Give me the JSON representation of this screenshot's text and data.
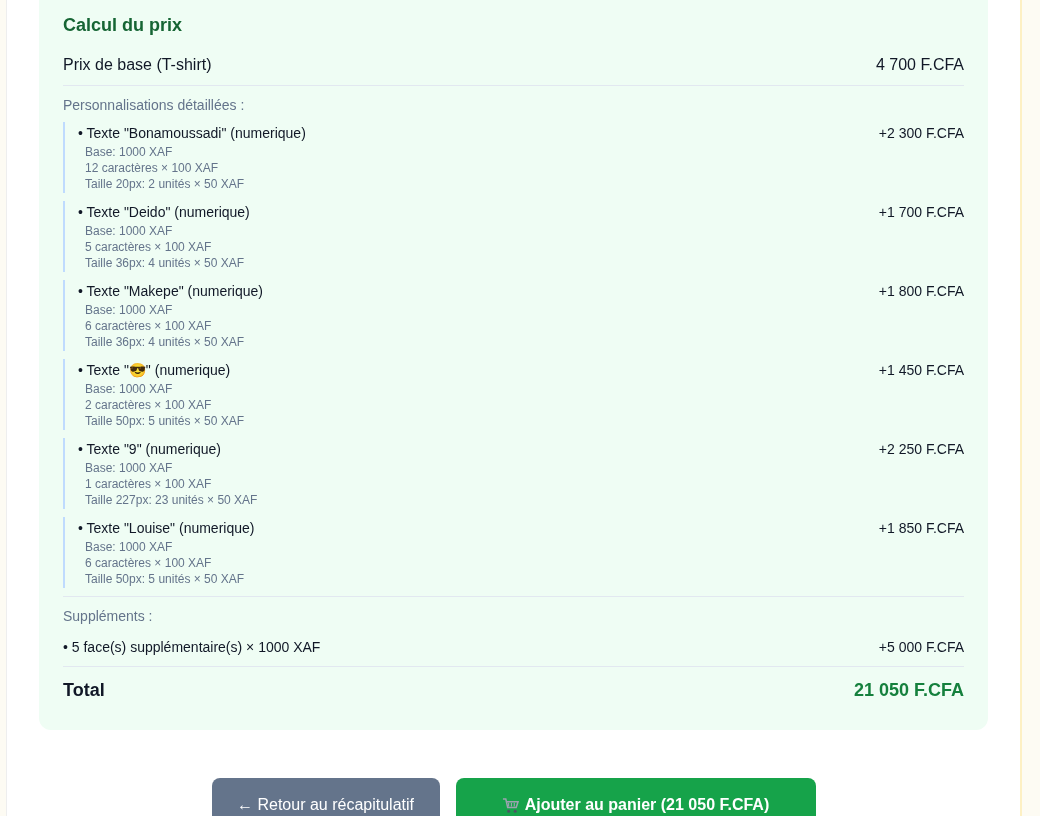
{
  "panel": {
    "title": "Calcul du prix",
    "base": {
      "label": "Prix de base (T-shirt)",
      "amount": "4 700 F.CFA"
    },
    "customizations_heading": "Personnalisations détaillées :",
    "customizations": [
      {
        "title": "• Texte \"Bonamoussadi\" (numerique)",
        "amount": "+2 300 F.CFA",
        "details": [
          "Base: 1000 XAF",
          "12 caractères × 100 XAF",
          "Taille 20px: 2 unités × 50 XAF"
        ]
      },
      {
        "title": "• Texte \"Deido\" (numerique)",
        "amount": "+1 700 F.CFA",
        "details": [
          "Base: 1000 XAF",
          "5 caractères × 100 XAF",
          "Taille 36px: 4 unités × 50 XAF"
        ]
      },
      {
        "title": "• Texte \"Makepe\" (numerique)",
        "amount": "+1 800 F.CFA",
        "details": [
          "Base: 1000 XAF",
          "6 caractères × 100 XAF",
          "Taille 36px: 4 unités × 50 XAF"
        ]
      },
      {
        "title": "• Texte \"😎\" (numerique)",
        "amount": "+1 450 F.CFA",
        "details": [
          "Base: 1000 XAF",
          "2 caractères × 100 XAF",
          "Taille 50px: 5 unités × 50 XAF"
        ]
      },
      {
        "title": "• Texte \"9\" (numerique)",
        "amount": "+2 250 F.CFA",
        "details": [
          "Base: 1000 XAF",
          "1 caractères × 100 XAF",
          "Taille 227px: 23 unités × 50 XAF"
        ]
      },
      {
        "title": "• Texte \"Louise\" (numerique)",
        "amount": "+1 850 F.CFA",
        "details": [
          "Base: 1000 XAF",
          "6 caractères × 100 XAF",
          "Taille 50px: 5 unités × 50 XAF"
        ]
      }
    ],
    "supplements_heading": "Suppléments :",
    "supplements": [
      {
        "label": "• 5 face(s) supplémentaire(s) × 1000 XAF",
        "amount": "+5 000 F.CFA"
      }
    ],
    "total": {
      "label": "Total",
      "amount": "21 050 F.CFA"
    }
  },
  "buttons": [
    {
      "kind": "back",
      "label": "← Retour au récapitulatif"
    },
    {
      "kind": "cart",
      "label": "Ajouter au panier (21 050 F.CFA)"
    }
  ]
}
